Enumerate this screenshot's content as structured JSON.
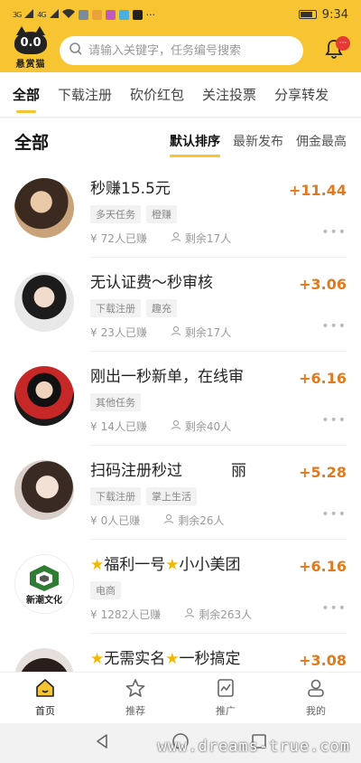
{
  "status_bar": {
    "signal_1": "3G",
    "signal_2": "4G",
    "dots": "···",
    "time": "9:34"
  },
  "header": {
    "logo_face": "0.0",
    "logo_text": "悬赏猫",
    "search_placeholder": "请输入关键字，任务编号搜索",
    "bell_badge": "···",
    "accent_color": "#f7c531"
  },
  "category_tabs": [
    {
      "label": "全部",
      "active": true
    },
    {
      "label": "下载注册",
      "active": false
    },
    {
      "label": "砍价红包",
      "active": false
    },
    {
      "label": "关注投票",
      "active": false
    },
    {
      "label": "分享转发",
      "active": false
    }
  ],
  "section": {
    "title": "全部",
    "sort_options": [
      {
        "label": "默认排序",
        "active": true
      },
      {
        "label": "最新发布",
        "active": false
      },
      {
        "label": "佣金最高",
        "active": false
      }
    ]
  },
  "tasks": [
    {
      "title": "秒赚15.5元",
      "tags": [
        "多天任务",
        "橙赚"
      ],
      "earned": "72人已赚",
      "remaining": "剩余17人",
      "reward": "+11.44",
      "more": "•••"
    },
    {
      "title": "无认证费～秒审核",
      "tags": [
        "下载注册",
        "趣充"
      ],
      "earned": "23人已赚",
      "remaining": "剩余17人",
      "reward": "+3.06",
      "more": "•••"
    },
    {
      "title": "刚出一秒新单，在线审",
      "tags": [
        "其他任务"
      ],
      "earned": "14人已赚",
      "remaining": "剩余40人",
      "reward": "+6.16",
      "more": "•••"
    },
    {
      "title": "扫码注册秒过          丽",
      "tags": [
        "下载注册",
        "掌上生活"
      ],
      "earned": "0人已赚",
      "remaining": "剩余26人",
      "reward": "+5.28",
      "more": "•••"
    },
    {
      "title": "福利一号",
      "title_2": "小小美团",
      "tags": [
        "电商"
      ],
      "earned": "1282人已赚",
      "remaining": "剩余263人",
      "reward": "+6.16",
      "more": "•••",
      "avatar_text": "新潮文化"
    },
    {
      "title": "无需实名",
      "title_2": "一秒搞定",
      "tags": [],
      "earned": "",
      "remaining": "",
      "reward": "+3.08",
      "more": ""
    }
  ],
  "bottom_nav": [
    {
      "label": "首页",
      "icon": "home-icon",
      "active": true
    },
    {
      "label": "推荐",
      "icon": "star-icon",
      "active": false
    },
    {
      "label": "推广",
      "icon": "chart-card-icon",
      "active": false
    },
    {
      "label": "我的",
      "icon": "user-icon",
      "active": false
    }
  ],
  "watermark": "www.dreams-true.com",
  "reward_color": "#e07a1f"
}
